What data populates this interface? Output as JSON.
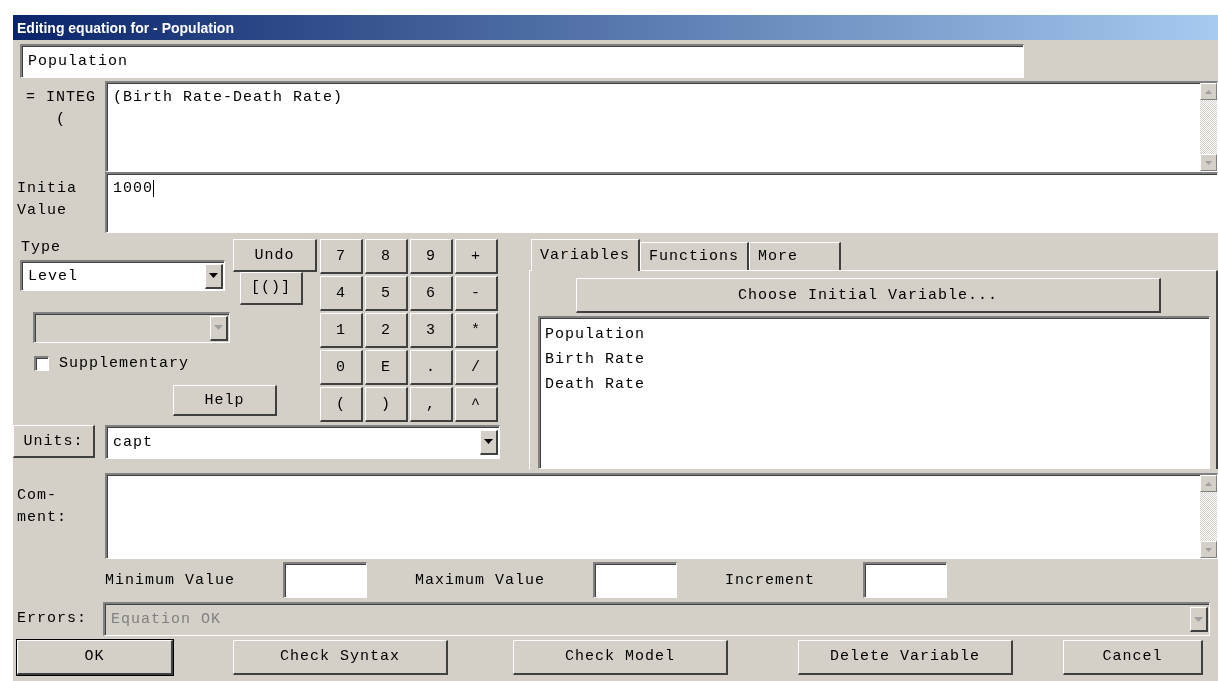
{
  "window": {
    "title": "Editing equation for - Population"
  },
  "name_field": {
    "value": "Population"
  },
  "equation": {
    "label_lines": [
      "= INTEG",
      "("
    ],
    "value": "(Birth Rate-Death Rate)"
  },
  "initial_value": {
    "label_lines": [
      "Initia",
      "Value"
    ],
    "value": "1000"
  },
  "type": {
    "label": "Type",
    "value": "Level"
  },
  "subtype": {
    "disabled": true
  },
  "supplementary": {
    "label": "Supplementary",
    "checked": false
  },
  "undo_button": "Undo",
  "bracket_button": "[()]",
  "help_button": "Help",
  "keypad": [
    "7",
    "8",
    "9",
    "+",
    "4",
    "5",
    "6",
    "-",
    "1",
    "2",
    "3",
    "*",
    "0",
    "E",
    ".",
    "/",
    "(",
    ")",
    ",",
    "^"
  ],
  "units": {
    "label": "Units:",
    "value": "capt"
  },
  "tabs": [
    {
      "label": "Variables",
      "selected": true
    },
    {
      "label": "Functions",
      "selected": false
    },
    {
      "label": "More",
      "selected": false
    }
  ],
  "choose_button": "Choose Initial Variable...",
  "variables": [
    "Population",
    "Birth Rate",
    "Death Rate"
  ],
  "comment": {
    "label_lines": [
      "Com-",
      "ment:"
    ]
  },
  "ranges": [
    {
      "label": "Minimum Value"
    },
    {
      "label": "Maximum Value"
    },
    {
      "label": "Increment"
    }
  ],
  "errors": {
    "label": "Errors:",
    "value": "Equation OK",
    "disabled": true
  },
  "buttons": [
    {
      "label": "OK",
      "default": true
    },
    {
      "label": "Check Syntax",
      "default": false
    },
    {
      "label": "Check Model",
      "default": false
    },
    {
      "label": "Delete Variable",
      "default": false
    },
    {
      "label": "Cancel",
      "default": false
    }
  ]
}
